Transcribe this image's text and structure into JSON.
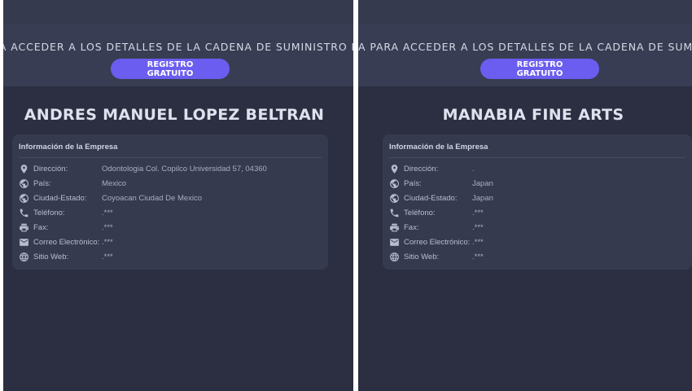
{
  "banner": {
    "left_text": "PARA ACCEDER A LOS DETALLES DE LA CADENA DE SUMINISTRO D",
    "right_text": "A PARA ACCEDER A LOS DETALLES DE LA CADENA DE SUMINISTRO",
    "button_label": "REGISTRO GRATUITO"
  },
  "colors": {
    "background": "#2b2f41",
    "card": "#353a4f",
    "accent": "#6b5df0"
  },
  "panels": [
    {
      "company_name": "ANDRES MANUEL LOPEZ BELTRAN",
      "card_title": "Información de la Empresa",
      "fields": [
        {
          "icon": "location-pin-icon",
          "label": "Dirección:",
          "value": "Odontologia Col. Copilco Universidad 57, 04360"
        },
        {
          "icon": "globe-icon",
          "label": "País:",
          "value": "Mexico"
        },
        {
          "icon": "globe-icon",
          "label": "Ciudad-Estado:",
          "value": "Coyoacan Ciudad De Mexico"
        },
        {
          "icon": "phone-icon",
          "label": "Teléfono:",
          "value": ".***"
        },
        {
          "icon": "fax-icon",
          "label": "Fax:",
          "value": ".***"
        },
        {
          "icon": "email-icon",
          "label": "Correo Electrónico:",
          "value": ".***"
        },
        {
          "icon": "web-icon",
          "label": "Sitio Web:",
          "value": ".***"
        }
      ]
    },
    {
      "company_name": "MANABIA FINE ARTS",
      "card_title": "Información de la Empresa",
      "fields": [
        {
          "icon": "location-pin-icon",
          "label": "Dirección:",
          "value": "."
        },
        {
          "icon": "globe-icon",
          "label": "País:",
          "value": "Japan"
        },
        {
          "icon": "globe-icon",
          "label": "Ciudad-Estado:",
          "value": "Japan"
        },
        {
          "icon": "phone-icon",
          "label": "Teléfono:",
          "value": ".***"
        },
        {
          "icon": "fax-icon",
          "label": "Fax:",
          "value": ".***"
        },
        {
          "icon": "email-icon",
          "label": "Correo Electrónico:",
          "value": ".***"
        },
        {
          "icon": "web-icon",
          "label": "Sitio Web:",
          "value": ".***"
        }
      ]
    }
  ]
}
